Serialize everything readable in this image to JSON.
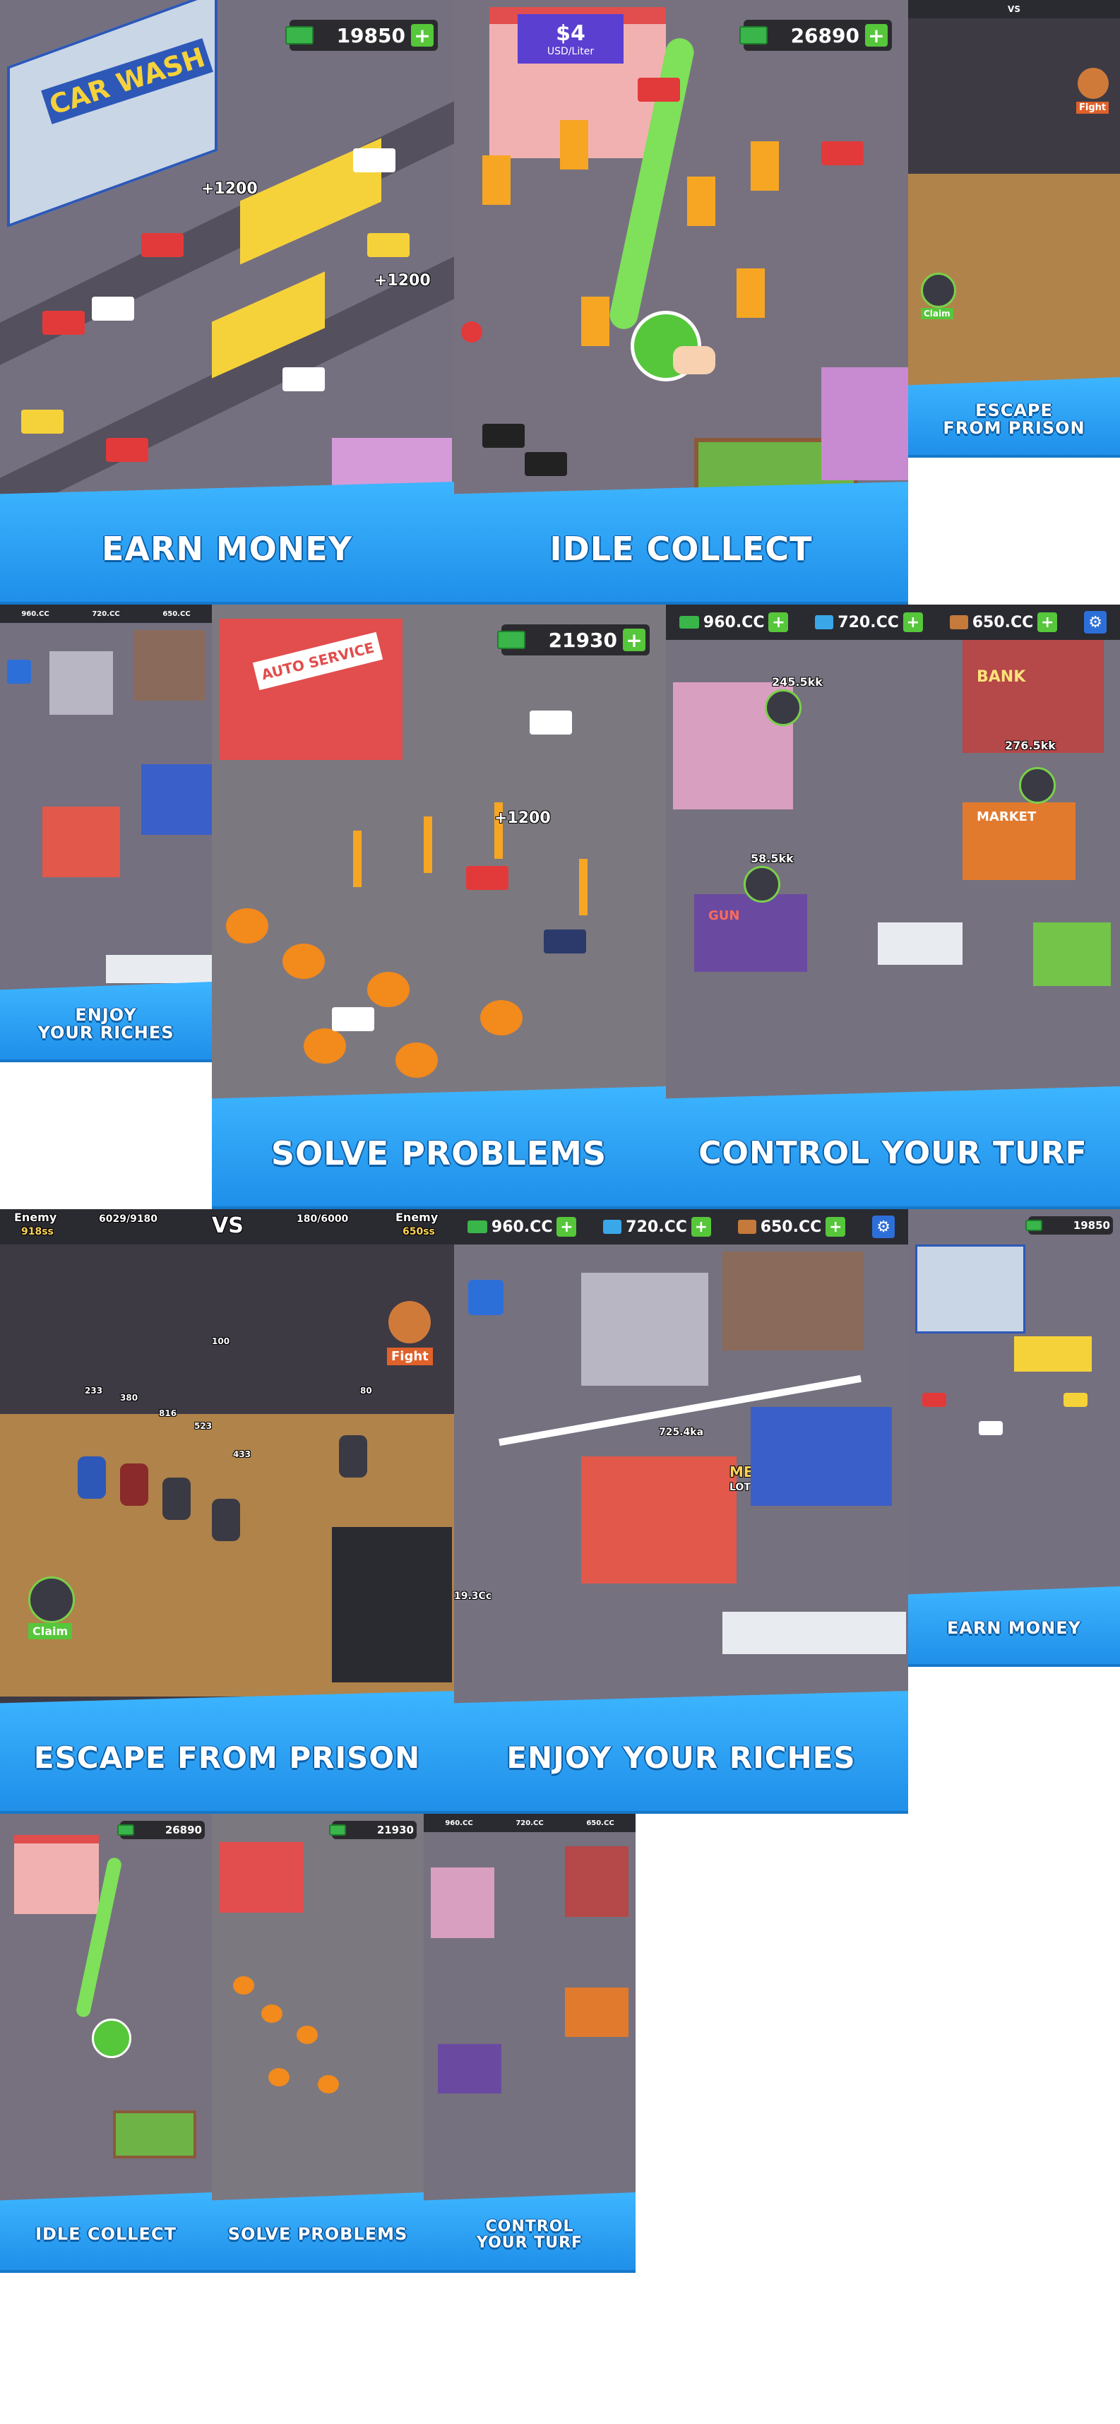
{
  "tiles": {
    "earn_money_large": {
      "caption": "EARN MONEY",
      "cash": "19850",
      "float1": "+1200",
      "float2": "+1200",
      "sign": "CAR WASH"
    },
    "idle_collect_large": {
      "caption": "IDLE COLLECT",
      "cash": "26890",
      "price_sign": "$4",
      "price_unit": "USD/Liter"
    },
    "escape_small": {
      "caption": "ESCAPE\nFROM PRISON",
      "fight": "Fight",
      "claim": "Claim"
    },
    "enjoy_small": {
      "caption": "ENJOY\nYOUR RICHES"
    },
    "solve_large": {
      "caption": "SOLVE PROBLEMS",
      "cash": "21930",
      "float": "+1200",
      "sign": "AUTO SERVICE"
    },
    "turf_large": {
      "caption": "CONTROL YOUR TURF",
      "res1": "960.CC",
      "res2": "720.CC",
      "res3": "650.CC",
      "val1": "245.5kk",
      "val2": "276.5kk",
      "val3": "58.5kk",
      "bank": "BANK",
      "market": "MARKET",
      "gun": "GUN"
    },
    "escape_large": {
      "caption": "ESCAPE FROM PRISON",
      "enemy_left": "Enemy",
      "left_score": "918ss",
      "left_hp": "6029/9180",
      "vs": "VS",
      "right_hp": "180/6000",
      "enemy_right": "Enemy",
      "right_score": "650ss",
      "fight": "Fight",
      "claim": "Claim",
      "dmg": [
        "100",
        "380",
        "816",
        "523",
        "233",
        "80",
        "433"
      ]
    },
    "enjoy_large": {
      "caption": "ENJOY YOUR RICHES",
      "res1": "960.CC",
      "res2": "720.CC",
      "res3": "650.CC",
      "val": "725.4ka",
      "mega": "MEGA",
      "lottery": "LOTTERY",
      "val2": "19.3Cc"
    },
    "earn_small": {
      "caption": "EARN MONEY",
      "cash": "19850"
    },
    "idle_small": {
      "caption": "IDLE COLLECT",
      "cash": "26890"
    },
    "solve_small": {
      "caption": "SOLVE PROBLEMS",
      "cash": "21930"
    },
    "turf_small": {
      "caption": "CONTROL\nYOUR TURF",
      "res1": "960.CC",
      "res2": "720.CC",
      "res3": "650.CC"
    }
  },
  "colors": {
    "caption": "#2a9cf5",
    "cash_plus": "#56c63b",
    "road": "#54505e",
    "yellow": "#f6d23a"
  }
}
